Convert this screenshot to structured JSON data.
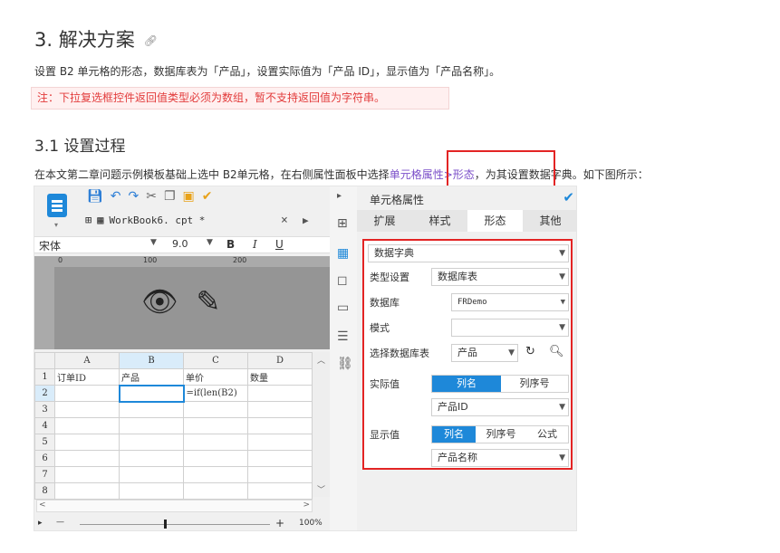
{
  "article": {
    "heading": "3. 解决方案",
    "link_icon": "link-icon",
    "intro": "设置 B2 单元格的形态，数据库表为「产品」，设置实际值为「产品 ID」，显示值为「产品名称」。",
    "note": "注：下拉复选框控件返回值类型必须为数组，暂不支持返回值为字符串。",
    "subheading": "3.1 设置过程",
    "step_before": "在本文第二章问题示例模板基础上选中 B2单元格，在右侧属性面板中选择",
    "step_highlight": "单元格属性>形态",
    "step_after": "，为其设置数据字典。如下图所示："
  },
  "designer": {
    "tab_label": "WorkBook6. cpt *",
    "tab_close": "×",
    "font_name": "宋体",
    "font_size": "9.0",
    "bold": "B",
    "italic": "I",
    "underline": "U",
    "ruler_ticks": [
      "0",
      "100",
      "200"
    ],
    "column_headers": [
      "",
      "A",
      "B",
      "C",
      "D"
    ],
    "rows": [
      {
        "n": "1",
        "a": "订单ID",
        "b": "产品",
        "c": "单价",
        "d": "数量"
      },
      {
        "n": "2",
        "a": "",
        "b": "",
        "c": "=if(len(B2)",
        "d": ""
      },
      {
        "n": "3",
        "a": "",
        "b": "",
        "c": "",
        "d": ""
      },
      {
        "n": "4",
        "a": "",
        "b": "",
        "c": "",
        "d": ""
      },
      {
        "n": "5",
        "a": "",
        "b": "",
        "c": "",
        "d": ""
      },
      {
        "n": "6",
        "a": "",
        "b": "",
        "c": "",
        "d": ""
      },
      {
        "n": "7",
        "a": "",
        "b": "",
        "c": "",
        "d": ""
      },
      {
        "n": "8",
        "a": "",
        "b": "",
        "c": "",
        "d": ""
      }
    ],
    "zoom": "100%",
    "zoom_minus": "—",
    "zoom_plus": "+"
  },
  "panel": {
    "title": "单元格属性",
    "tabs": [
      "扩展",
      "样式",
      "形态",
      "其他"
    ],
    "active_tab": "形态",
    "widget_type": "数据字典",
    "type_setting_label": "类型设置",
    "type_setting_value": "数据库表",
    "database_label": "数据库",
    "database_value": "FRDemo",
    "mode_label": "模式",
    "mode_value": "",
    "table_label": "选择数据库表",
    "table_value": "产品",
    "actual_label": "实际值",
    "actual_options": [
      "列名",
      "列序号"
    ],
    "actual_value": "产品ID",
    "display_label": "显示值",
    "display_options": [
      "列名",
      "列序号",
      "公式"
    ],
    "display_value": "产品名称"
  },
  "colors": {
    "accent": "#1e88d9",
    "highlight_box": "#e32424",
    "note_text": "#e23b3b",
    "link_purple": "#7b4fc9"
  }
}
